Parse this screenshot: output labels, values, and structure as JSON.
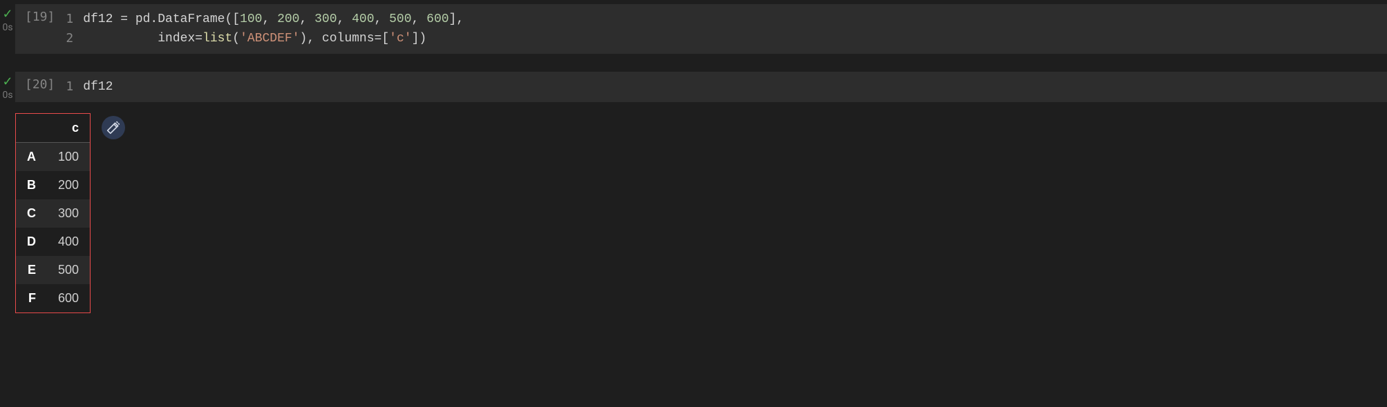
{
  "cells": [
    {
      "status": "success",
      "check_glyph": "✓",
      "timing": "0s",
      "exec_count": "[19]",
      "line_nums": [
        "1",
        "2"
      ],
      "code": {
        "line1": {
          "a": "df12 ",
          "b": "=",
          "c": " pd.DataFrame([",
          "n1": "100",
          "s1": ", ",
          "n2": "200",
          "s2": ", ",
          "n3": "300",
          "s3": ", ",
          "n4": "400",
          "s4": ", ",
          "n5": "500",
          "s5": ", ",
          "n6": "600",
          "d": "],"
        },
        "line2": {
          "indent": "··········",
          "a": "index",
          "b": "=",
          "fn": "list",
          "c": "(",
          "str1": "'ABCDEF'",
          "d": "), columns",
          "e": "=",
          "f": "[",
          "str2": "'c'",
          "g": "])"
        }
      }
    },
    {
      "status": "success",
      "check_glyph": "✓",
      "timing": "0s",
      "exec_count": "[20]",
      "line_nums": [
        "1"
      ],
      "code": {
        "line1": {
          "a": "df12"
        }
      },
      "output": {
        "columns": [
          "c"
        ],
        "index": [
          "A",
          "B",
          "C",
          "D",
          "E",
          "F"
        ],
        "values": [
          100,
          200,
          300,
          400,
          500,
          600
        ]
      }
    }
  ],
  "icons": {
    "magic": "magic-wand-icon"
  }
}
